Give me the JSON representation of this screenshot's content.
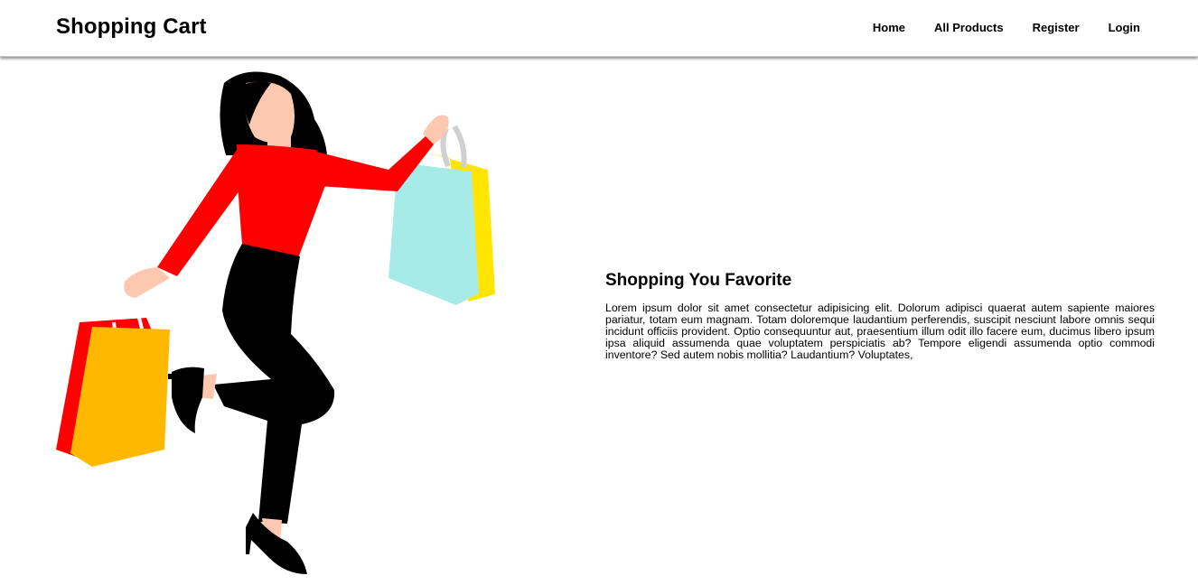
{
  "navbar": {
    "brand": "Shopping Cart",
    "links": [
      {
        "label": "Home"
      },
      {
        "label": "All Products"
      },
      {
        "label": "Register"
      },
      {
        "label": "Login"
      }
    ]
  },
  "hero": {
    "illustration": "woman-with-shopping-bags-illustration",
    "title": "Shopping You Favorite",
    "text": "Lorem ipsum dolor sit amet consectetur adipisicing elit. Dolorum adipisci quaerat autem sapiente maiores pariatur, totam eum magnam. Totam doloremque laudantium perferendis, suscipit nesciunt labore omnis sequi incidunt officiis provident. Optio consequuntur aut, praesentium illum odit illo facere eum, ducimus libero ipsum ipsa aliquid assumenda quae voluptatem perspiciatis ab? Tempore eligendi assumenda optio commodi inventore? Sed autem nobis mollitia? Laudantium? Voluptates,"
  },
  "colors": {
    "shirt": "#ff0000",
    "pants": "#000000",
    "skin": "#fcc9b0",
    "bag_yellow": "#ffe500",
    "bag_cyan": "#a6ebe7",
    "bag_orange": "#ffb800",
    "bag_red": "#ff0000"
  }
}
